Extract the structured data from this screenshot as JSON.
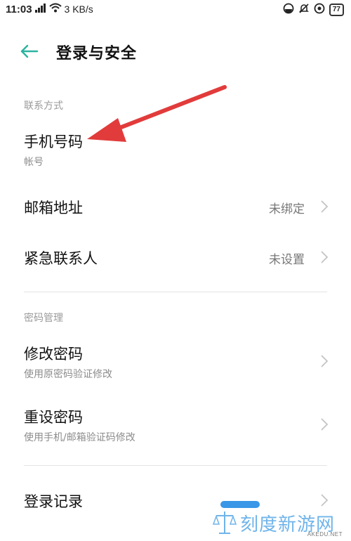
{
  "status_bar": {
    "time": "11:03",
    "net_speed": "3 KB/s",
    "battery": "77",
    "icons": [
      "signal-icon",
      "wifi-icon",
      "theme-icon",
      "mute-icon",
      "at-icon",
      "battery-icon"
    ]
  },
  "header": {
    "back_icon": "back-arrow-icon",
    "title": "登录与安全"
  },
  "sections": {
    "contact": {
      "label": "联系方式",
      "items": [
        {
          "title": "手机号码",
          "subtitle": "帐号"
        },
        {
          "title": "邮箱地址",
          "value": "未绑定"
        },
        {
          "title": "紧急联系人",
          "value": "未设置"
        }
      ]
    },
    "password": {
      "label": "密码管理",
      "items": [
        {
          "title": "修改密码",
          "subtitle": "使用原密码验证修改"
        },
        {
          "title": "重设密码",
          "subtitle": "使用手机/邮箱验证码修改"
        }
      ]
    },
    "other": {
      "items": [
        {
          "title": "登录记录"
        }
      ]
    }
  },
  "annotation": {
    "arrow_color": "#e23b3b"
  },
  "colors": {
    "accent": "#2bb3a0",
    "watermark": "#6fb4ea"
  },
  "watermark": {
    "text": "刻度新游网",
    "url": "AKEDU.NET"
  }
}
